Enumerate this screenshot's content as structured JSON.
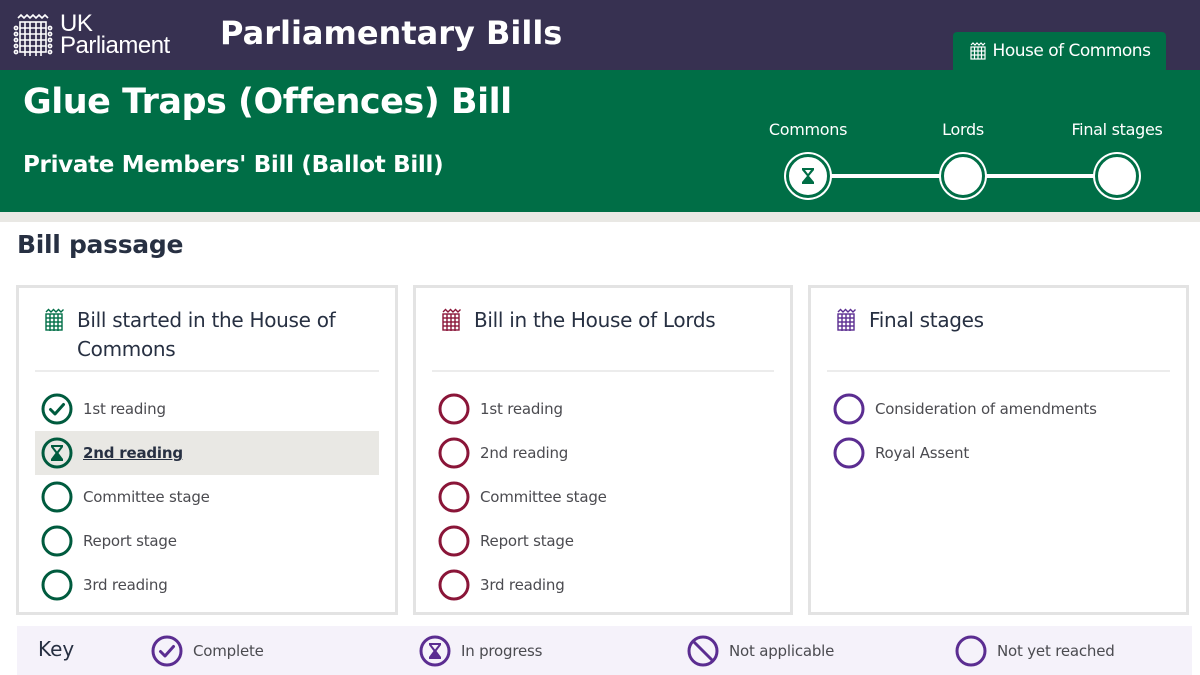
{
  "header": {
    "logo_text_line1": "UK",
    "logo_text_line2": "Parliament",
    "site_title": "Parliamentary Bills",
    "house_tab": {
      "label": "House of Commons",
      "icon": "portcullis-icon"
    }
  },
  "banner": {
    "bill_title": "Glue Traps (Offences) Bill",
    "bill_type": "Private Members' Bill (Ballot Bill)",
    "progress": [
      {
        "label": "Commons",
        "status": "in-progress"
      },
      {
        "label": "Lords",
        "status": "not-yet-reached"
      },
      {
        "label": "Final stages",
        "status": "not-yet-reached"
      }
    ]
  },
  "bill_passage": {
    "title": "Bill passage",
    "cards": [
      {
        "title": "Bill started in the House of Commons",
        "color": "#005b3e",
        "stages": [
          {
            "label": "1st reading",
            "status": "complete"
          },
          {
            "label": "2nd reading",
            "status": "in-progress"
          },
          {
            "label": "Committee stage",
            "status": "not-yet-reached"
          },
          {
            "label": "Report stage",
            "status": "not-yet-reached"
          },
          {
            "label": "3rd reading",
            "status": "not-yet-reached"
          }
        ]
      },
      {
        "title": "Bill in the House of Lords",
        "color": "#8a1538",
        "stages": [
          {
            "label": "1st reading",
            "status": "not-yet-reached"
          },
          {
            "label": "2nd reading",
            "status": "not-yet-reached"
          },
          {
            "label": "Committee stage",
            "status": "not-yet-reached"
          },
          {
            "label": "Report stage",
            "status": "not-yet-reached"
          },
          {
            "label": "3rd reading",
            "status": "not-yet-reached"
          }
        ]
      },
      {
        "title": "Final stages",
        "color": "#5b2d91",
        "stages": [
          {
            "label": "Consideration of amendments",
            "status": "not-yet-reached"
          },
          {
            "label": "Royal Assent",
            "status": "not-yet-reached"
          }
        ]
      }
    ]
  },
  "key": {
    "title": "Key",
    "color": "#5b2d91",
    "items": [
      {
        "label": "Complete",
        "icon": "check-circle-icon"
      },
      {
        "label": "In progress",
        "icon": "hourglass-icon"
      },
      {
        "label": "Not applicable",
        "icon": "not-applicable-icon"
      },
      {
        "label": "Not yet reached",
        "icon": "empty-circle-icon"
      }
    ]
  },
  "colors": {
    "topbar": "#373151",
    "commons_green": "#006e46",
    "lords_red": "#8a1538",
    "final_purple": "#5b2d91"
  }
}
